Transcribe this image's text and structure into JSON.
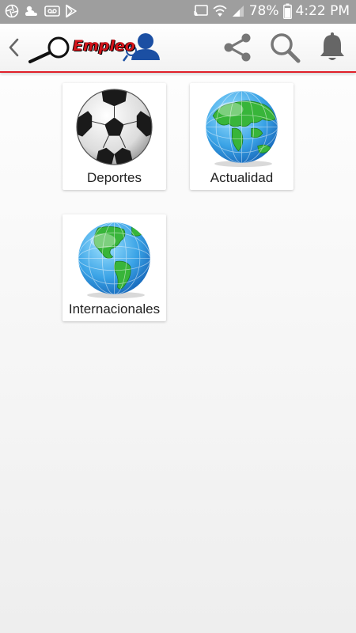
{
  "status_bar": {
    "battery_percent": "78%",
    "time": "4:22 PM",
    "icons": [
      "aperture-icon",
      "weather-icon",
      "voicemail-icon",
      "play-store-icon",
      "cast-icon",
      "wifi-icon",
      "signal-icon",
      "battery-icon"
    ]
  },
  "app_bar": {
    "logo_text": "Empleo",
    "actions": [
      "share-icon",
      "search-icon",
      "bell-icon"
    ],
    "accent_color": "#e0202a"
  },
  "categories": [
    {
      "label": "Deportes",
      "icon": "soccer-ball-icon"
    },
    {
      "label": "Actualidad",
      "icon": "globe-eurasia-icon"
    },
    {
      "label": "Internacionales",
      "icon": "globe-americas-icon"
    }
  ]
}
